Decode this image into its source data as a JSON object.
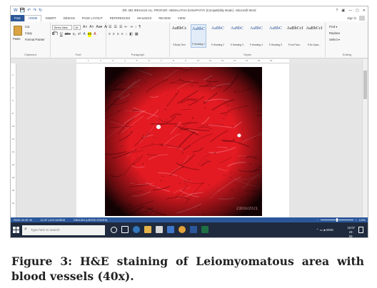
{
  "window": {
    "title": "DR. MD.IREHAUS ALI, PROF.DR. HEMALATHA DANAPATHY [Compatibility Mode] - Microsoft Word",
    "quick_access": [
      "W",
      "💾",
      "↶",
      "↷",
      "↻"
    ],
    "controls": [
      "?",
      "▣",
      "—",
      "▢",
      "✕"
    ]
  },
  "ribbon_tabs": [
    "FILE",
    "HOME",
    "INSERT",
    "DESIGN",
    "PAGE LAYOUT",
    "REFERENCES",
    "MAILINGS",
    "REVIEW",
    "VIEW"
  ],
  "active_tab": "HOME",
  "sign_in": "Sign in",
  "clipboard": {
    "paste": "Paste",
    "cut": "Cut",
    "copy": "Copy",
    "format_painter": "Format Painter",
    "label": "Clipboard"
  },
  "font": {
    "name": "Times New Ro",
    "size": "16",
    "row1": [
      "A˄",
      "A˅",
      "Aa▾",
      "A̷"
    ],
    "row2": [
      "B",
      "I",
      "U",
      "abc",
      "x₂",
      "x²",
      "A",
      "ab",
      "A"
    ],
    "label": "Font"
  },
  "paragraph": {
    "row1": [
      "☰",
      "☰",
      "☰",
      "⇤",
      "⇥",
      "↕",
      "¶"
    ],
    "row2": [
      "≡",
      "≡",
      "≡",
      "≡",
      "↕",
      "◧",
      "▦"
    ],
    "label": "Paragraph"
  },
  "styles": {
    "items": [
      {
        "sample": "AaBbCc",
        "name": "¶ Body Text",
        "selected": false,
        "heading": false
      },
      {
        "sample": "AaBbC",
        "name": "¶ Heading 1",
        "selected": true,
        "heading": true
      },
      {
        "sample": "AaBbC",
        "name": "¶ Heading 2",
        "selected": false,
        "heading": true
      },
      {
        "sample": "AaBbC",
        "name": "¶ Heading 3",
        "selected": false,
        "heading": true
      },
      {
        "sample": "AaBbC",
        "name": "¶ Heading 4",
        "selected": false,
        "heading": true
      },
      {
        "sample": "AaBbC",
        "name": "¶ Heading 5",
        "selected": false,
        "heading": true
      },
      {
        "sample": "AaBbCcI",
        "name": "¶ List Para...",
        "selected": false,
        "heading": false
      },
      {
        "sample": "AaBbCcI",
        "name": "¶ No Spac...",
        "selected": false,
        "heading": false
      }
    ],
    "label": "Styles"
  },
  "editing": {
    "find": "Find ▾",
    "replace": "Replace",
    "select": "Select ▾",
    "label": "Editing"
  },
  "ruler_marks": [
    "1",
    "2",
    "3",
    "4",
    "5",
    "6",
    "7",
    "8",
    "9",
    "10",
    "11",
    "12",
    "13",
    "14",
    "15",
    "16"
  ],
  "vruler_marks": [
    "2",
    "4",
    "6",
    "8",
    "10",
    "12",
    "14",
    "16",
    "18",
    "20",
    "22"
  ],
  "photo": {
    "stain_color": "#e31a22",
    "dark_color": "#7a0c10",
    "date_stamp": "23/01/2021"
  },
  "status": {
    "page": "PAGE 40 OF 49",
    "words": "11 OF 1,874 WORDS",
    "language": "ENGLISH (UNITED STATES)",
    "zoom": "120%",
    "zoom_level": 0.5
  },
  "taskbar": {
    "search_placeholder": "Type here to search",
    "time": "10:07",
    "date": "23-02-2021",
    "tray": "⌃ ▭ 🕪 ENG"
  },
  "caption": "Figure 3: H&E staining of Leiomyomatous area with blood vessels (40x)."
}
